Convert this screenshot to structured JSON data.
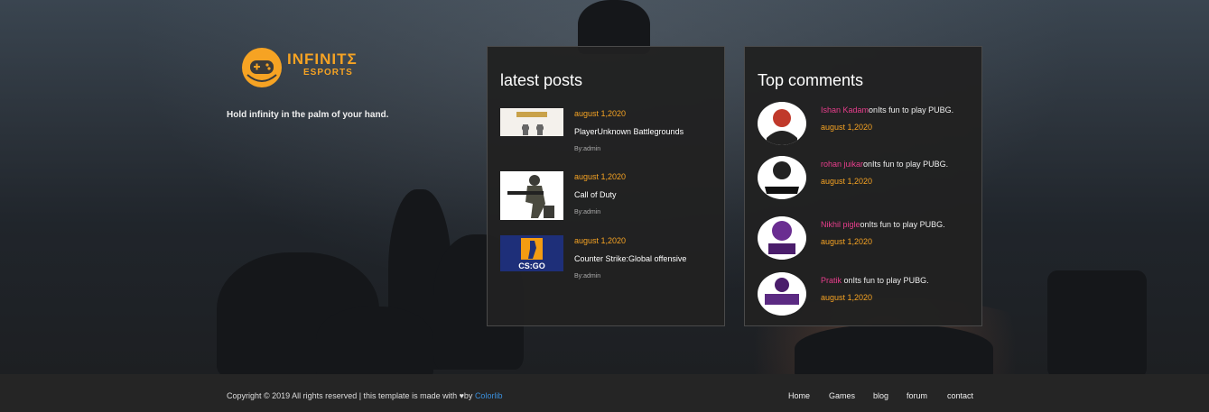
{
  "brand": {
    "name": "INFINITΣ",
    "sub": "ESPORTS",
    "tagline": "Hold infinity in the palm of your hand."
  },
  "latest_posts": {
    "heading": "latest posts",
    "items": [
      {
        "date": "august 1,2020",
        "title": "PlayerUnknown Battlegrounds",
        "author": "By:admin"
      },
      {
        "date": "august 1,2020",
        "title": "Call of Duty",
        "author": "By:admin"
      },
      {
        "date": "august 1,2020",
        "title": "Counter Strike:Global offensive",
        "author": "By:admin"
      }
    ]
  },
  "top_comments": {
    "heading": "Top comments",
    "items": [
      {
        "name": "Ishan Kadam",
        "sep": "on",
        "text": "Its fun to play PUBG.",
        "date": "august 1,2020"
      },
      {
        "name": "rohan juikar",
        "sep": "on",
        "text": "Its fun to play PUBG.",
        "date": "august 1,2020"
      },
      {
        "name": "Nikhil pigle",
        "sep": "on",
        "text": "Its fun to play PUBG.",
        "date": "august 1,2020"
      },
      {
        "name": "Pratik",
        "sep": " on",
        "text": "Its fun to play PUBG.",
        "date": "august 1,2020"
      }
    ]
  },
  "footer": {
    "copyright": "Copyright © 2019 All rights reserved | this template is made with ♥by ",
    "credit": "Colorlib",
    "nav": [
      "Home",
      "Games",
      "blog",
      "forum",
      "contact"
    ]
  },
  "colors": {
    "accent": "#f6a323",
    "commenter": "#e83e8c",
    "link": "#3a8fdc"
  }
}
